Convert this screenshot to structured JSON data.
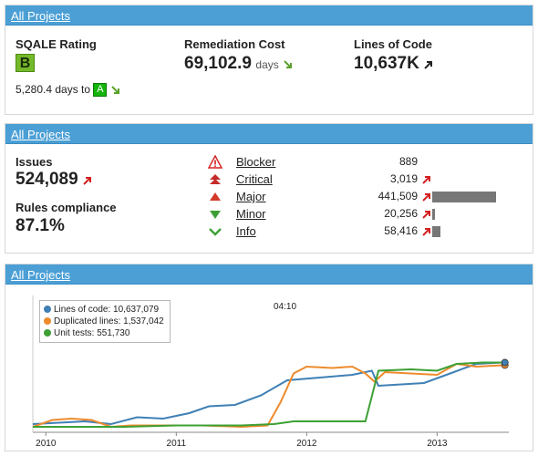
{
  "widget1": {
    "header": "All Projects",
    "sqale": {
      "label": "SQALE Rating",
      "rating": "B",
      "days_text": "5,280.4 days to",
      "target_rating": "A"
    },
    "remediation": {
      "label": "Remediation Cost",
      "value": "69,102.9",
      "unit": "days"
    },
    "loc": {
      "label": "Lines of Code",
      "value": "10,637K"
    }
  },
  "widget2": {
    "header": "All Projects",
    "issues": {
      "label": "Issues",
      "value": "524,089"
    },
    "rules": {
      "label": "Rules compliance",
      "value": "87.1%"
    },
    "severities": [
      {
        "name": "Blocker",
        "count": "889",
        "icon": "blocker-icon",
        "bar_fraction": 0.0
      },
      {
        "name": "Critical",
        "count": "3,019",
        "icon": "critical-icon",
        "bar_fraction": 0.0
      },
      {
        "name": "Major",
        "count": "441,509",
        "icon": "major-icon",
        "bar_fraction": 1.0
      },
      {
        "name": "Minor",
        "count": "20,256",
        "icon": "minor-icon",
        "bar_fraction": 0.046
      },
      {
        "name": "Info",
        "count": "58,416",
        "icon": "info-icon",
        "bar_fraction": 0.132
      }
    ]
  },
  "widget3": {
    "header": "All Projects",
    "legend": {
      "loc": "Lines of code: 10,637,079",
      "dup": "Duplicated lines: 1,537,042",
      "tests": "Unit tests: 551,730"
    },
    "time": "04:10"
  },
  "colors": {
    "header": "#4b9fd5",
    "loc": "#3f80b5",
    "dup": "#ee8b2c",
    "tests": "#3da035",
    "bar": "#777777"
  },
  "chart_data": {
    "type": "line",
    "xlim": [
      2009.9,
      2013.55
    ],
    "x_ticks": [
      "2010",
      "2011",
      "2012",
      "2013"
    ],
    "series": [
      {
        "name": "Lines of code",
        "color": "#3f80b5",
        "points": [
          [
            2009.9,
            0.06
          ],
          [
            2010.1,
            0.07
          ],
          [
            2010.3,
            0.08
          ],
          [
            2010.5,
            0.06
          ],
          [
            2010.7,
            0.11
          ],
          [
            2010.9,
            0.1
          ],
          [
            2011.1,
            0.14
          ],
          [
            2011.25,
            0.19
          ],
          [
            2011.45,
            0.2
          ],
          [
            2011.65,
            0.27
          ],
          [
            2011.85,
            0.38
          ],
          [
            2012.1,
            0.4
          ],
          [
            2012.35,
            0.42
          ],
          [
            2012.5,
            0.45
          ],
          [
            2012.55,
            0.34
          ],
          [
            2012.9,
            0.36
          ],
          [
            2013.1,
            0.43
          ],
          [
            2013.3,
            0.5
          ],
          [
            2013.5,
            0.51
          ]
        ]
      },
      {
        "name": "Duplicated lines",
        "color": "#ee8b2c",
        "points": [
          [
            2009.9,
            0.04
          ],
          [
            2010.05,
            0.09
          ],
          [
            2010.2,
            0.1
          ],
          [
            2010.35,
            0.09
          ],
          [
            2010.5,
            0.04
          ],
          [
            2010.65,
            0.05
          ],
          [
            2010.9,
            0.05
          ],
          [
            2011.2,
            0.05
          ],
          [
            2011.5,
            0.04
          ],
          [
            2011.7,
            0.05
          ],
          [
            2011.8,
            0.22
          ],
          [
            2011.9,
            0.43
          ],
          [
            2012.0,
            0.48
          ],
          [
            2012.2,
            0.47
          ],
          [
            2012.35,
            0.48
          ],
          [
            2012.45,
            0.43
          ],
          [
            2012.52,
            0.37
          ],
          [
            2012.6,
            0.44
          ],
          [
            2012.8,
            0.43
          ],
          [
            2013.0,
            0.42
          ],
          [
            2013.15,
            0.5
          ],
          [
            2013.3,
            0.48
          ],
          [
            2013.5,
            0.49
          ]
        ]
      },
      {
        "name": "Unit tests",
        "color": "#3da035",
        "points": [
          [
            2009.9,
            0.04
          ],
          [
            2010.3,
            0.04
          ],
          [
            2010.6,
            0.04
          ],
          [
            2011.0,
            0.05
          ],
          [
            2011.5,
            0.05
          ],
          [
            2011.75,
            0.06
          ],
          [
            2011.9,
            0.08
          ],
          [
            2012.2,
            0.08
          ],
          [
            2012.45,
            0.08
          ],
          [
            2012.55,
            0.45
          ],
          [
            2012.8,
            0.46
          ],
          [
            2013.0,
            0.45
          ],
          [
            2013.15,
            0.5
          ],
          [
            2013.35,
            0.51
          ],
          [
            2013.5,
            0.51
          ]
        ]
      }
    ],
    "grid": false,
    "legend_placement": "top-left"
  }
}
